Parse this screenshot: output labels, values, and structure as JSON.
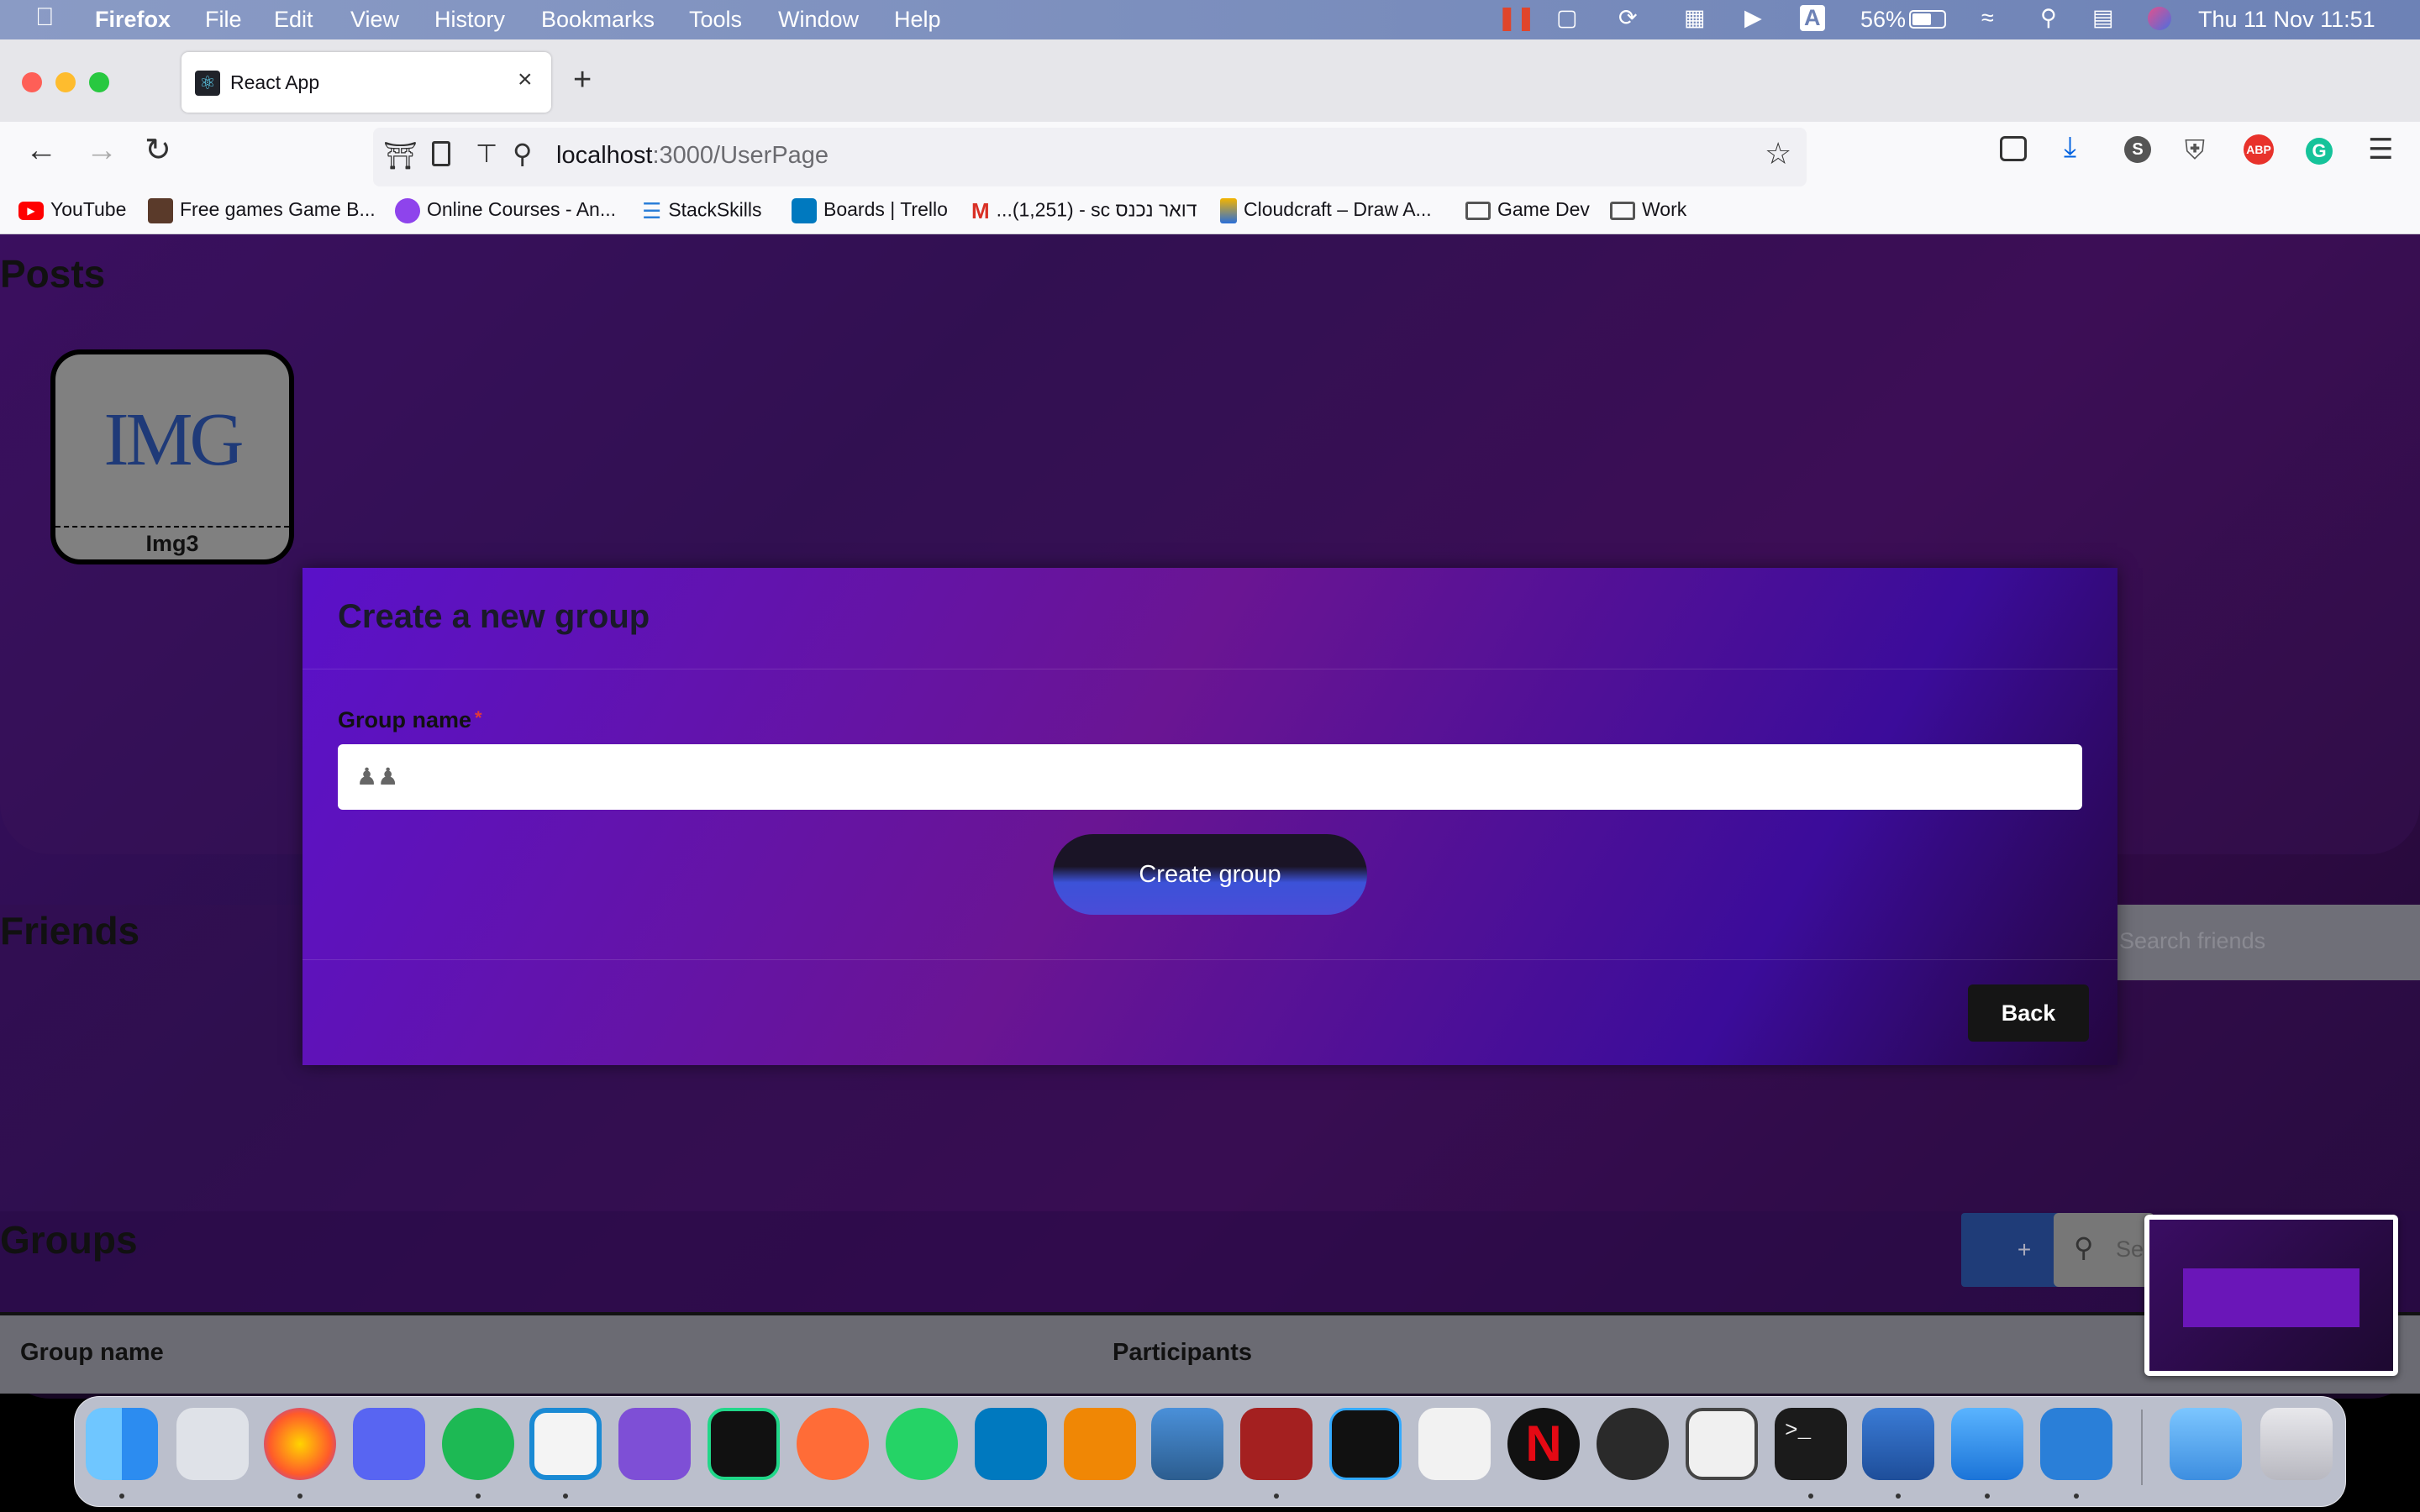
{
  "menubar": {
    "app_name": "Firefox",
    "items": [
      "File",
      "Edit",
      "View",
      "History",
      "Bookmarks",
      "Tools",
      "Window",
      "Help"
    ],
    "battery": "56%",
    "datetime": "Thu 11 Nov  11:51"
  },
  "browser": {
    "tab_title": "React App",
    "url_host": "localhost",
    "url_path": ":3000/UserPage",
    "bookmarks": [
      "YouTube",
      "Free games Game B...",
      "Online Courses - An...",
      "StackSkills",
      "Boards | Trello",
      "...(1,251) - sc דואר נכנס",
      "Cloudcraft – Draw A...",
      "Game Dev",
      "Work"
    ]
  },
  "page": {
    "posts_title": "Posts",
    "post_card_label": "Img3",
    "post_card_logo": "IMG",
    "friends_title": "Friends",
    "friends_search_placeholder": "Search friends",
    "groups_title": "Groups",
    "groups_add_label": "+",
    "groups_search_placeholder": "Se",
    "table_headers": [
      "Group name",
      "Participants"
    ]
  },
  "modal": {
    "title": "Create a new group",
    "field_label": "Group name",
    "required_mark": "*",
    "input_value": "",
    "create_button": "Create group",
    "back_button": "Back"
  },
  "colors": {
    "modal_accent": "#5a11c9",
    "page_background": "#2c0f4e",
    "create_button": "#3c52d8"
  },
  "dock_apps": [
    "finder-icon",
    "launchpad-icon",
    "firefox-icon",
    "discord-icon",
    "spotify-icon",
    "vscode-icon",
    "visual-studio-icon",
    "pycharm-icon",
    "postman-icon",
    "whatsapp-icon",
    "trello-icon",
    "drawio-icon",
    "preview-icon",
    "database-icon",
    "gamemaker-icon",
    "unity-icon",
    "netflix-icon",
    "lens-icon",
    "itch-icon",
    "terminal-icon",
    "parallels-icon",
    "windows-icon",
    "search-app-icon",
    "folder-icon",
    "trash-icon"
  ]
}
